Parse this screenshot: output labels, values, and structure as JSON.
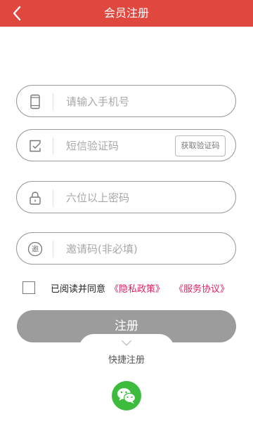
{
  "header": {
    "title": "会员注册"
  },
  "form": {
    "phone_placeholder": "请输入手机号",
    "sms_placeholder": "短信验证码",
    "get_code_label": "获取验证码",
    "password_placeholder": "六位以上密码",
    "invite_placeholder": "邀请码(非必填)",
    "invite_icon_char": "邀"
  },
  "agreement": {
    "prefix": "已阅读并同意",
    "privacy_link": "《隐私政策》",
    "service_link": "《服务协议》"
  },
  "actions": {
    "register_label": "注册",
    "quick_register_label": "快捷注册"
  },
  "colors": {
    "header_bg": "#e0473e",
    "link": "#e02060",
    "register_button": "#9c9c9c",
    "wechat": "#3dbb3d"
  },
  "icons": {
    "back": "chevron-left-icon",
    "phone": "phone-icon",
    "sms": "message-check-icon",
    "password": "lock-icon",
    "invite": "invite-badge-icon",
    "quick_register": "chevron-down-icon",
    "wechat": "wechat-icon"
  }
}
